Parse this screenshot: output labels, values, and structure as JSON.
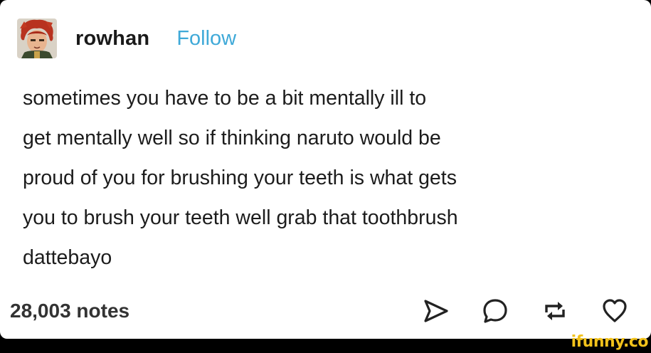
{
  "post": {
    "username": "rowhan",
    "follow_label": "Follow",
    "text_lines": [
      "sometimes you have to be a bit mentally ill to",
      "get mentally well so if thinking naruto would be",
      "proud of you for brushing your teeth is what gets",
      "you to brush your teeth well grab that toothbrush",
      "dattebayo"
    ],
    "notes": "28,003 notes",
    "actions": [
      {
        "name": "share",
        "icon": "send-icon"
      },
      {
        "name": "reply",
        "icon": "comment-icon"
      },
      {
        "name": "reblog",
        "icon": "reblog-icon"
      },
      {
        "name": "like",
        "icon": "heart-icon"
      }
    ]
  },
  "watermark": "ifunny.co",
  "colors": {
    "follow": "#3fa9d8",
    "text": "#1c1c1c",
    "icons": "#222222",
    "background": "#ffffff",
    "watermark": "#f2c21b"
  }
}
